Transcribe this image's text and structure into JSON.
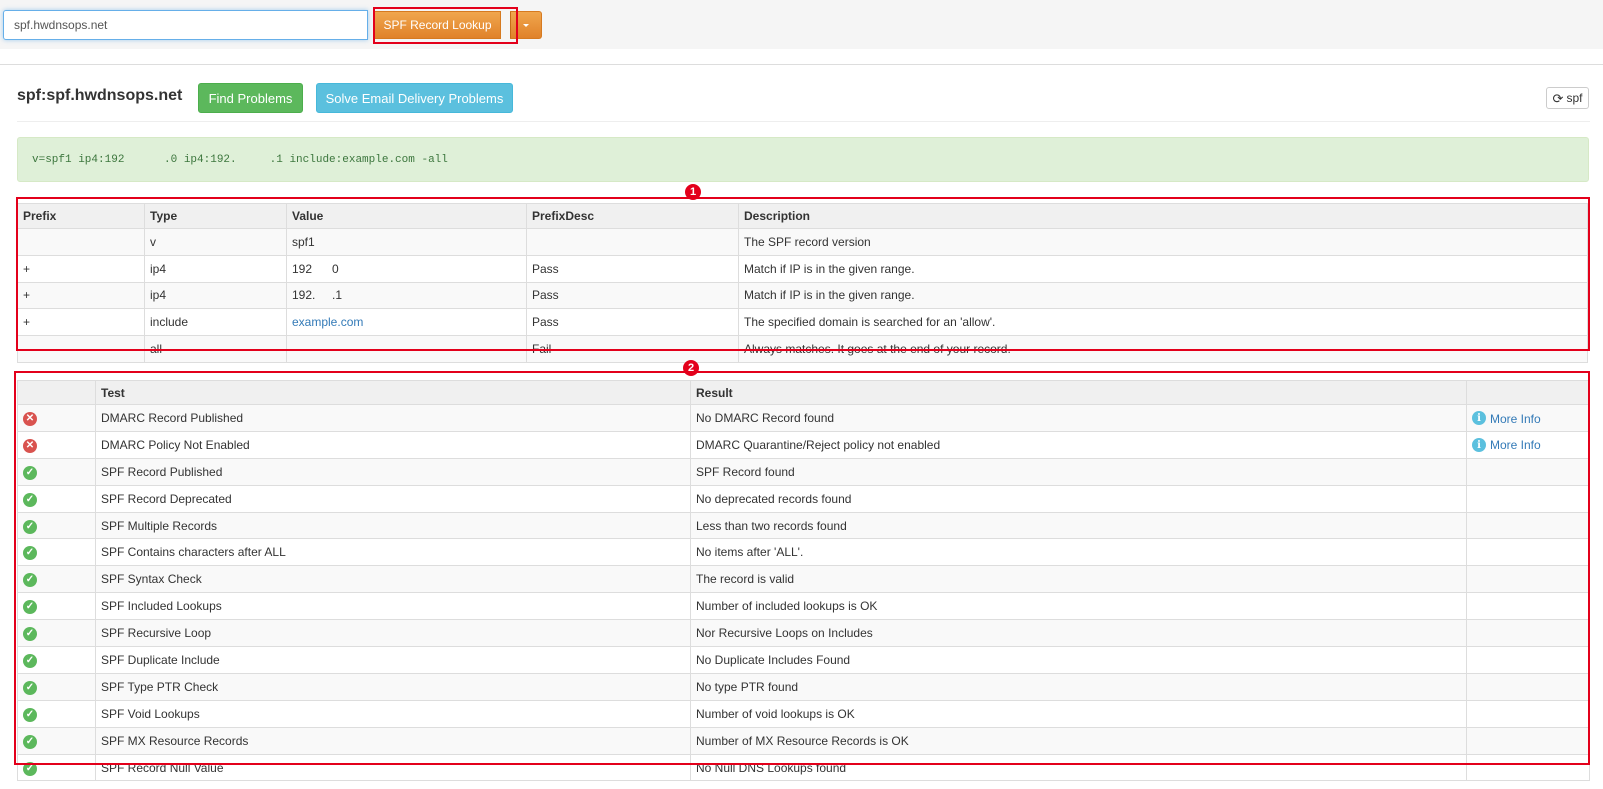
{
  "search": {
    "value": "spf.hwdnsops.net"
  },
  "lookup_button": {
    "label": "SPF Record Lookup"
  },
  "header": {
    "title": "spf:spf.hwdnsops.net",
    "find_problems_label": "Find Problems",
    "solve_email_label": "Solve Email Delivery Problems",
    "refresh_label": "spf"
  },
  "record": {
    "text": "v=spf1 ip4:192      .0 ip4:192.     .1 include:example.com -all"
  },
  "markers": {
    "spf_table": "1",
    "test_table": "2"
  },
  "spf_table": {
    "columns": [
      "Prefix",
      "Type",
      "Value",
      "PrefixDesc",
      "Description"
    ],
    "rows": [
      {
        "prefix": "",
        "type": "v",
        "value": "spf1",
        "prefix_desc": "",
        "description": "The SPF record version",
        "value_is_link": false
      },
      {
        "prefix": "+",
        "type": "ip4",
        "value": "192      0",
        "prefix_desc": "Pass",
        "description": "Match if IP is in the given range.",
        "value_is_link": false
      },
      {
        "prefix": "+",
        "type": "ip4",
        "value": "192.     .1",
        "prefix_desc": "Pass",
        "description": "Match if IP is in the given range.",
        "value_is_link": false
      },
      {
        "prefix": "+",
        "type": "include",
        "value": "example.com",
        "prefix_desc": "Pass",
        "description": "The specified domain is searched for an 'allow'.",
        "value_is_link": true
      },
      {
        "prefix": "-",
        "type": "all",
        "value": "",
        "prefix_desc": "Fail",
        "description": "Always matches. It goes at the end of your record.",
        "value_is_link": false
      }
    ]
  },
  "test_table": {
    "columns": [
      "",
      "Test",
      "Result",
      ""
    ],
    "more_info_label": "More Info",
    "rows": [
      {
        "status": "fail",
        "test": "DMARC Record Published",
        "result": "No DMARC Record found",
        "more_info": true
      },
      {
        "status": "fail",
        "test": "DMARC Policy Not Enabled",
        "result": "DMARC Quarantine/Reject policy not enabled",
        "more_info": true
      },
      {
        "status": "pass",
        "test": "SPF Record Published",
        "result": "SPF Record found",
        "more_info": false
      },
      {
        "status": "pass",
        "test": "SPF Record Deprecated",
        "result": "No deprecated records found",
        "more_info": false
      },
      {
        "status": "pass",
        "test": "SPF Multiple Records",
        "result": "Less than two records found",
        "more_info": false
      },
      {
        "status": "pass",
        "test": "SPF Contains characters after ALL",
        "result": "No items after 'ALL'.",
        "more_info": false
      },
      {
        "status": "pass",
        "test": "SPF Syntax Check",
        "result": "The record is valid",
        "more_info": false
      },
      {
        "status": "pass",
        "test": "SPF Included Lookups",
        "result": "Number of included lookups is OK",
        "more_info": false
      },
      {
        "status": "pass",
        "test": "SPF Recursive Loop",
        "result": "Nor Recursive Loops on Includes",
        "more_info": false
      },
      {
        "status": "pass",
        "test": "SPF Duplicate Include",
        "result": "No Duplicate Includes Found",
        "more_info": false
      },
      {
        "status": "pass",
        "test": "SPF Type PTR Check",
        "result": "No type PTR found",
        "more_info": false
      },
      {
        "status": "pass",
        "test": "SPF Void Lookups",
        "result": "Number of void lookups is OK",
        "more_info": false
      },
      {
        "status": "pass",
        "test": "SPF MX Resource Records",
        "result": "Number of MX Resource Records is OK",
        "more_info": false
      },
      {
        "status": "pass",
        "test": "SPF Record Null Value",
        "result": "No Null DNS Lookups found",
        "more_info": false
      }
    ]
  },
  "colors": {
    "accent_orange": "#e0822a",
    "success": "#5cb85c",
    "info": "#5bc0de",
    "danger": "#d9534f",
    "highlight": "#e3001b"
  },
  "icons": {
    "fail": "x-circle-icon",
    "pass": "check-circle-icon",
    "info": "info-circle-icon",
    "refresh": "refresh-icon"
  }
}
